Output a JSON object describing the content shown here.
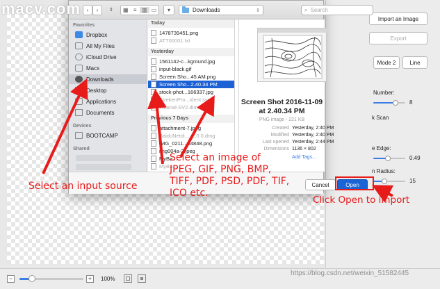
{
  "watermark": "macv.com",
  "dialog": {
    "toolbar": {
      "path": "Downloads",
      "search_placeholder": "Search"
    },
    "sidebar": {
      "favorites_header": "Favorites",
      "favorites": [
        "Dropbox",
        "All My Files",
        "iCloud Drive",
        "Macx",
        "Downloads",
        "Desktop",
        "Applications",
        "Documents"
      ],
      "selected": "Downloads",
      "devices_header": "Devices",
      "devices": [
        "BOOTCAMP"
      ],
      "shared_header": "Shared"
    },
    "files": {
      "today_header": "Today",
      "today": [
        "1478739451.png",
        "ATT00001.txt"
      ],
      "yesterday_header": "Yesterday",
      "yesterday": [
        "1561142-c...kground.jpg",
        "input-black.gif",
        "Screen Sho...45 AM.png",
        "Screen Sho...2.40.34 PM",
        "stock-phot...166337.jpg",
        "StrekenPro...ident.svg",
        "Tutorial-SV2.dim.zip"
      ],
      "previous_header": "Previous 7 Days",
      "previous": [
        "attachment-7.jpeg",
        "BaiduNetdi..._2.0.0.dmg",
        "IMG_0211...84848.png",
        "img004a-2.jpeg",
        "MyBa...",
        "MyBa..."
      ],
      "selected": "Screen Sho...2.40.34 PM"
    },
    "preview": {
      "title": "Screen Shot 2016-11-09 at 2.40.34 PM",
      "subtitle": "PNG image - 221 KB",
      "meta": [
        {
          "key": "Created",
          "value": "Yesterday, 2:40 PM"
        },
        {
          "key": "Modified",
          "value": "Yesterday, 2:40 PM"
        },
        {
          "key": "Last opened",
          "value": "Yesterday, 2:44 PM"
        },
        {
          "key": "Dimensions",
          "value": "1136 × 802"
        },
        {
          "key": "",
          "value": "Add Tags..."
        }
      ]
    },
    "buttons": {
      "cancel": "Cancel",
      "open": "Open"
    }
  },
  "right_panel": {
    "import_button": "Import an Image",
    "export_button": "Export",
    "mode2": "Mode 2",
    "line": "Line",
    "number_label": "Number:",
    "number_value": "8",
    "scan_label": "k Scan",
    "edge_label": "e Edge:",
    "edge_value": "0.49",
    "radius_label": "n Radius:",
    "radius_value": "15",
    "number_slider": 0.7,
    "edge_slider": 0.45,
    "radius_slider": 0.35
  },
  "bottom_bar": {
    "zoom_value": "100%",
    "zoom_slider": 0.18,
    "minus": "−",
    "plus": "+"
  },
  "annotations": {
    "input_source": "Select an input source",
    "select_image": [
      "Select an image of",
      "JPEG, GIF, PNG, BMP,",
      "TIFF, PDF, PSD, PDF, TIF,",
      "ICO etc."
    ],
    "click_open": "Click Open to import"
  },
  "csdn_watermark": "https://blog.csdn.net/weixin_51582445",
  "colors": {
    "accent": "#1a64d6",
    "annotation": "#e81b1b"
  }
}
